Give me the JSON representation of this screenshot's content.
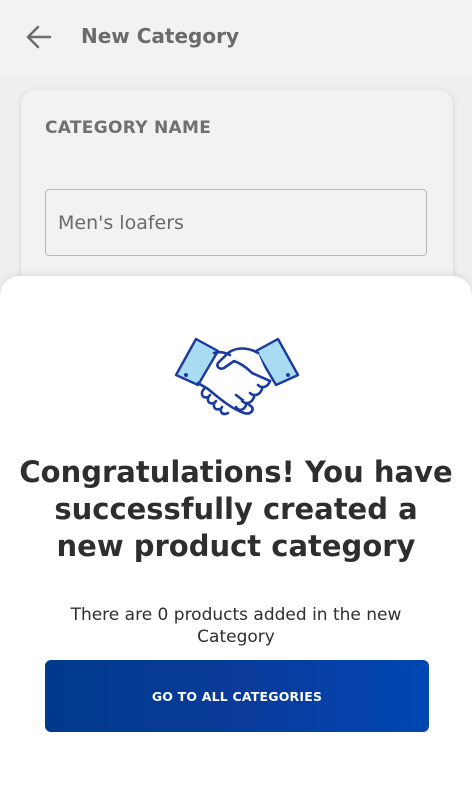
{
  "header": {
    "back_icon": "arrow-left-icon",
    "title": "New Category"
  },
  "form": {
    "label": "CATEGORY NAME",
    "name_value": "Men's loafers"
  },
  "success_sheet": {
    "illustration_icon": "handshake-icon",
    "headline": "Congratulations! You have successfully created a new product category",
    "subtext": "There are 0 products added in the new Category",
    "button_label": "GO TO ALL CATEGORIES"
  },
  "colors": {
    "button_primary": "#003a8c",
    "illustration_stroke": "#1a3a9e",
    "illustration_cuff": "#a9dcf3"
  }
}
